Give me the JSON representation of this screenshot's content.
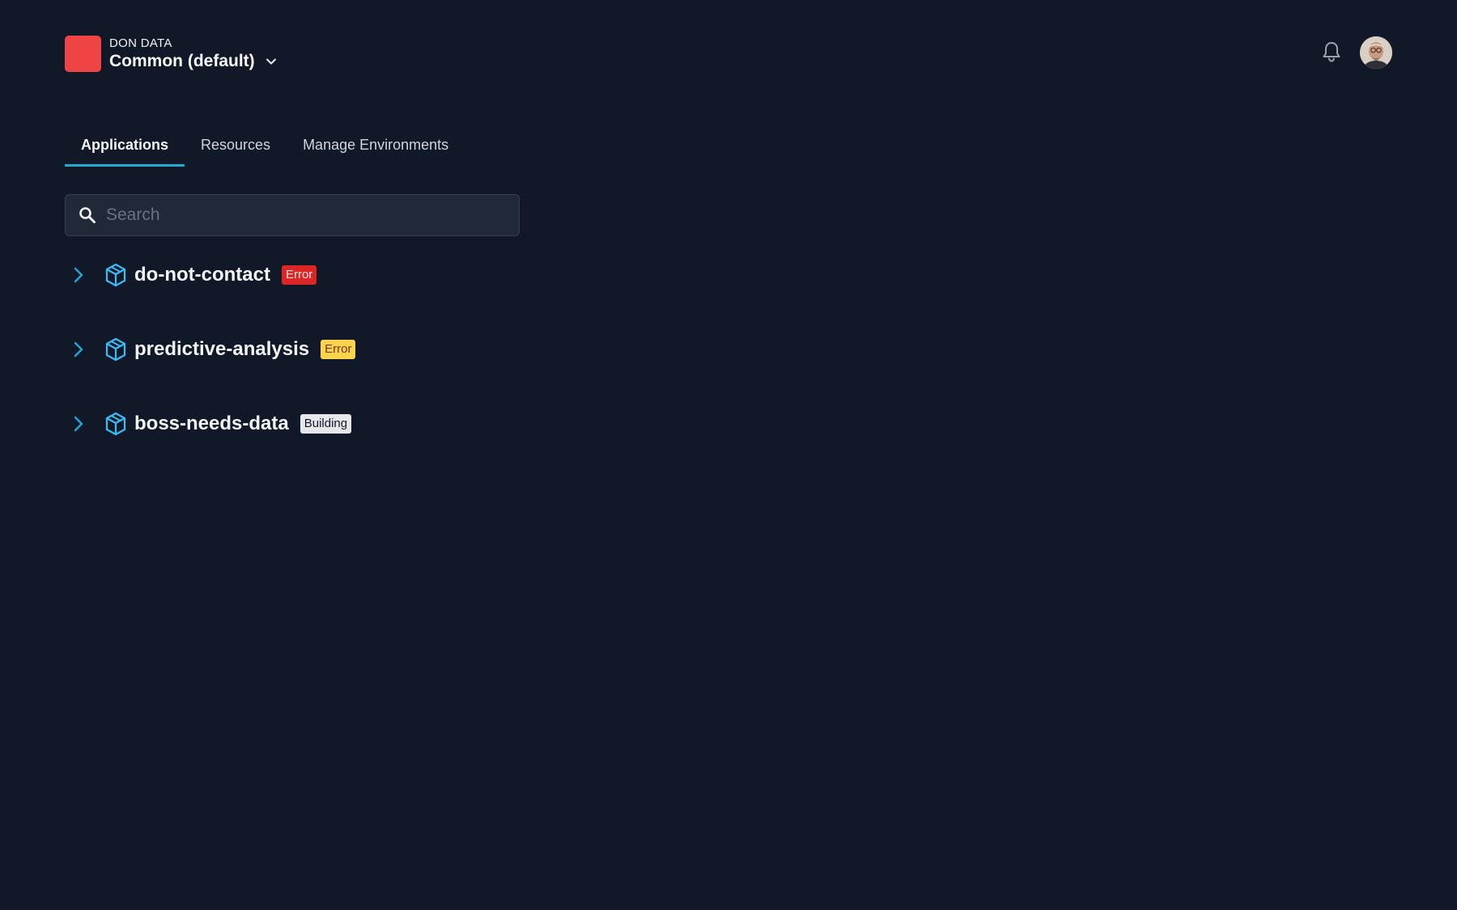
{
  "header": {
    "org_name": "DON DATA",
    "environment": "Common (default)",
    "logo_color": "#ef4444",
    "notification_icon": "bell-icon",
    "avatar": "user-avatar"
  },
  "tabs": [
    {
      "label": "Applications",
      "active": true
    },
    {
      "label": "Resources",
      "active": false
    },
    {
      "label": "Manage Environments",
      "active": false
    }
  ],
  "search": {
    "placeholder": "Search",
    "value": ""
  },
  "applications": [
    {
      "name": "do-not-contact",
      "status": "Error",
      "status_color": "#dc2626"
    },
    {
      "name": "predictive-analysis",
      "status": "Error",
      "status_color": "#fcd34d"
    },
    {
      "name": "boss-needs-data",
      "status": "Building",
      "status_color": "#e5e7eb"
    }
  ],
  "colors": {
    "background": "#111827",
    "accent": "#22a7d6",
    "icon_cyan": "#38bdf8"
  }
}
